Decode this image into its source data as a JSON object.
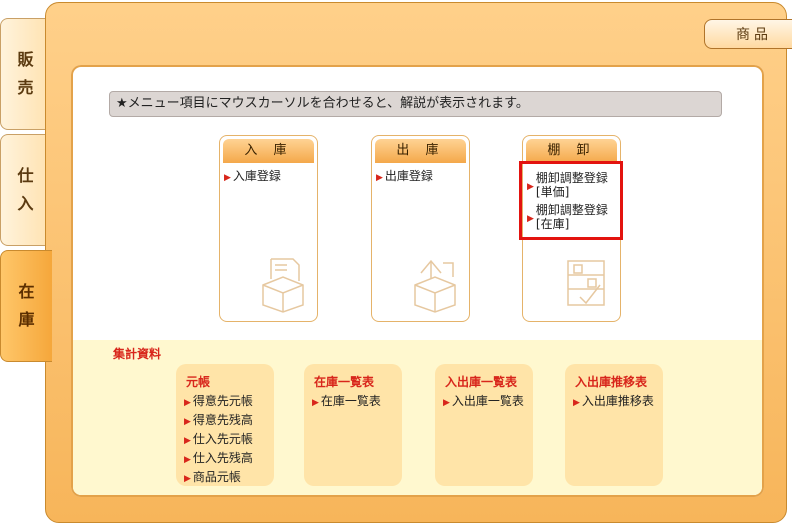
{
  "tabs": [
    {
      "chars": [
        "販",
        "売"
      ],
      "active": false
    },
    {
      "chars": [
        "仕",
        "入"
      ],
      "active": false
    },
    {
      "chars": [
        "在",
        "庫"
      ],
      "active": true
    }
  ],
  "top_button": "商品",
  "notice": "★メニュー項目にマウスカーソルを合わせると、解説が表示されます。",
  "cards": [
    {
      "title": "入 庫",
      "links": [
        "入庫登録"
      ]
    },
    {
      "title": "出 庫",
      "links": [
        "出庫登録"
      ]
    },
    {
      "title": "棚 卸",
      "links": [
        "棚卸調整登録\n[単価]",
        "棚卸調整登録\n[在庫]"
      ]
    }
  ],
  "aggregate": {
    "title": "集計資料",
    "groups": [
      {
        "title": "元帳",
        "links": [
          "得意先元帳",
          "得意先残高",
          "仕入先元帳",
          "仕入先残高",
          "商品元帳"
        ]
      },
      {
        "title": "在庫一覧表",
        "links": [
          "在庫一覧表"
        ]
      },
      {
        "title": "入出庫一覧表",
        "links": [
          "入出庫一覧表"
        ]
      },
      {
        "title": "入出庫推移表",
        "links": [
          "入出庫推移表"
        ]
      }
    ]
  },
  "colors": {
    "accent": "#f4a84a",
    "highlight": "#e3130f",
    "link_marker": "#d8261b"
  },
  "icons": [
    "box-icon",
    "box-icon",
    "inventory-check-icon"
  ]
}
